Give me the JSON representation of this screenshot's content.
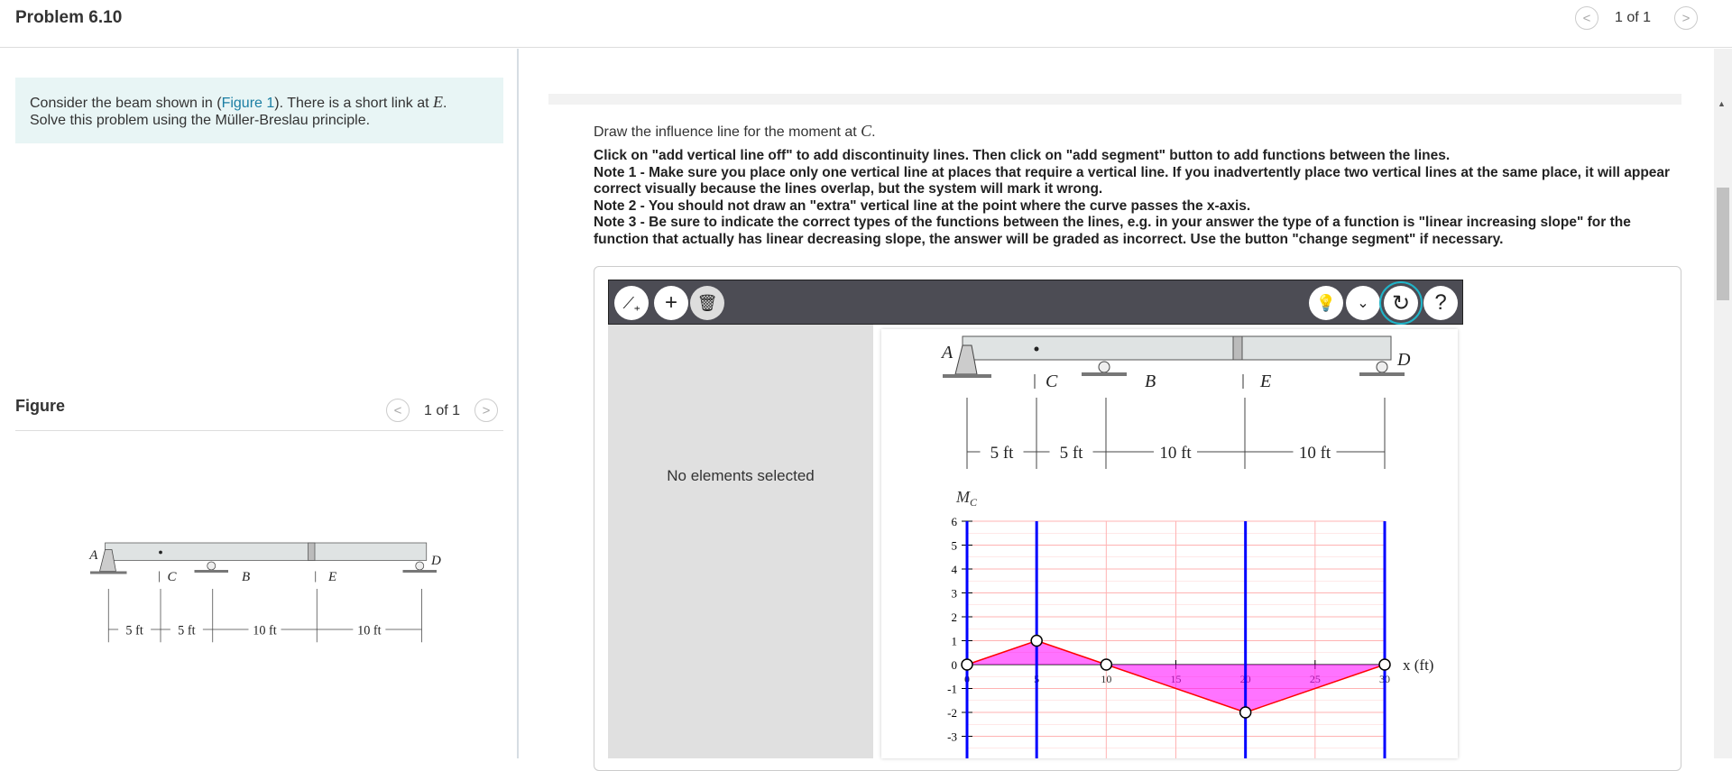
{
  "header": {
    "title": "Problem 6.10",
    "pager": "1 of 1"
  },
  "problem": {
    "text_before": "Consider the beam shown in (",
    "link": "Figure 1",
    "text_after": "). There is a short link at ",
    "var": "E",
    "text_end": ".",
    "line2": "Solve this problem using the Müller-Breslau principle."
  },
  "figure": {
    "label": "Figure",
    "pager": "1 of 1"
  },
  "main": {
    "prompt": "Draw the influence line for the moment at ",
    "prompt_var": "C",
    "notes": [
      "Click on \"add vertical line off\" to add discontinuity lines. Then click on \"add segment\" button to add functions between the lines.",
      "Note 1 - Make sure you place only one vertical line at places that require a vertical line. If you inadvertently place two vertical lines at the same place, it will appear correct visually because the lines overlap, but the system will mark it wrong.",
      "Note 2 - You should not draw an \"extra\" vertical line at the point where the curve passes the x-axis.",
      "Note 3 - Be sure to indicate the correct types of the functions between the lines, e.g. in your answer the type of a function is \"linear increasing slope\" for the function that actually has linear decreasing slope, the answer will be graded as incorrect. Use the button \"change segment\" if necessary."
    ]
  },
  "widget": {
    "tools_left": [
      "add-vertical-line-icon",
      "add-segment-icon",
      "trash-icon"
    ],
    "tools_right": [
      "hint-lightbulb-icon",
      "chevron-down-icon",
      "redo-icon",
      "help-icon"
    ],
    "help_label": "?",
    "no_selection": "No elements selected"
  },
  "beam": {
    "labels": {
      "A": "A",
      "B": "B",
      "C": "C",
      "D": "D",
      "E": "E"
    },
    "dims": [
      "5 ft",
      "5 ft",
      "10 ft",
      "10 ft"
    ]
  },
  "graph": {
    "ylabel": "M",
    "ylabel_sub": "C",
    "xlabel": "x (ft)",
    "xlim": [
      0,
      30
    ],
    "ylim": [
      -4,
      6
    ],
    "xticks": [
      0,
      5,
      10,
      15,
      20,
      25,
      30
    ],
    "yticks": [
      6,
      5,
      4,
      3,
      2,
      1,
      0,
      -1,
      -2,
      -3
    ],
    "vertical_lines": [
      0,
      5,
      20,
      30
    ],
    "points": [
      [
        0,
        0
      ],
      [
        5,
        1
      ],
      [
        10,
        0
      ],
      [
        20,
        -2
      ],
      [
        30,
        0
      ]
    ],
    "colors": {
      "line": "#ff0000",
      "fill": "#ff00ff",
      "vertical": "#0000ff",
      "grid": "#ffb3b3"
    }
  }
}
